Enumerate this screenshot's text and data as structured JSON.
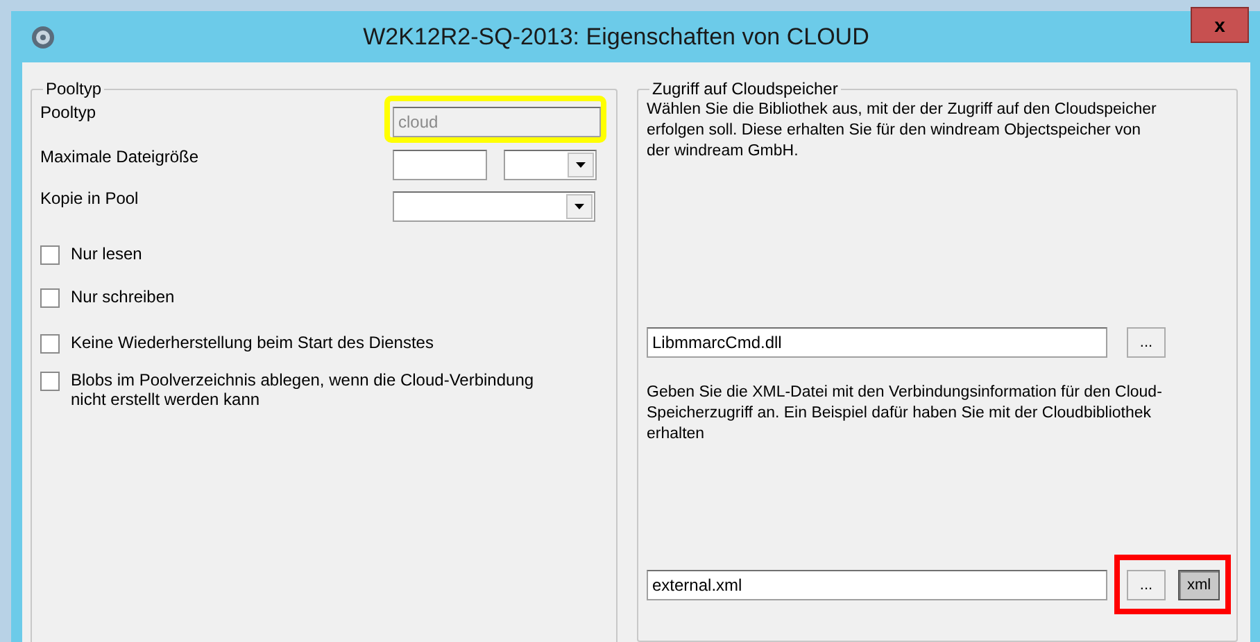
{
  "window": {
    "title": "W2K12R2-SQ-2013: Eigenschaften von CLOUD",
    "close": "x"
  },
  "pool_group": {
    "title": "Pooltyp",
    "fields": [
      {
        "kind": "text",
        "label": "Pooltyp",
        "value": "cloud",
        "disabled": true,
        "color": "#ffff00"
      },
      {
        "kind": "size",
        "label": "Maximale Dateigröße"
      },
      {
        "kind": "combo",
        "label": "Kopie in Pool"
      }
    ],
    "checkboxes": [
      {
        "label": "Nur lesen",
        "checked": false
      },
      {
        "label": "Nur schreiben",
        "checked": false
      },
      {
        "label": "Keine Wiederherstellung beim Start des Dienstes",
        "checked": false
      },
      {
        "label": "Blobs im Poolverzeichnis ablegen, wenn die Cloud-Verbindung nicht erstellt werden kann",
        "checked": false
      }
    ]
  },
  "cloud_group": {
    "title": "Zugriff auf Cloudspeicher",
    "library_hint": "Wählen Sie die Bibliothek aus, mit der der Zugriff auf den Cloudspeicher erfolgen soll. Diese erhalten Sie für den windream Objectspeicher von der windream GmbH.",
    "library_file": {
      "value": "LibmmarcCmd.dll",
      "browse": "..."
    },
    "xml_hint": "Geben Sie die XML-Datei mit den Verbindungsinformation für den Cloud-Speicherzugriff an. Ein Beispiel dafür haben Sie mit der Cloudbibliothek erhalten",
    "xml_file": {
      "value": "external.xml",
      "browse": "...",
      "xml_button": "xml",
      "color": "#ff0000"
    }
  }
}
